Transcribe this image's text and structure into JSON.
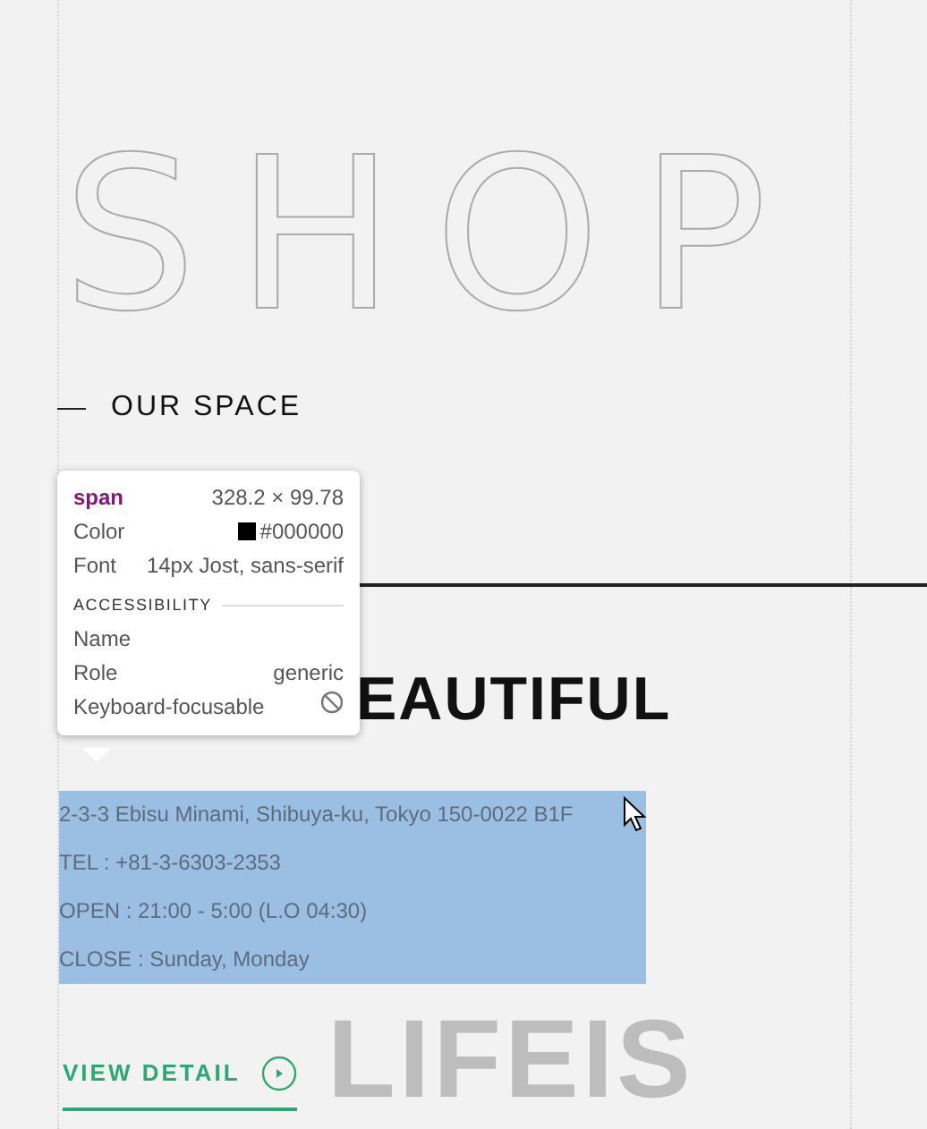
{
  "hero_title": "SHOP",
  "section_label": "OUR SPACE",
  "heading": "EAUTIFUL",
  "address_lines": [
    "2-3-3 Ebisu Minami, Shibuya-ku, Tokyo 150-0022 B1F",
    "TEL : +81-3-6303-2353",
    "OPEN : 21:00 - 5:00 (L.O 04:30)",
    "CLOSE : Sunday, Monday"
  ],
  "address_selected": true,
  "background_word": "LIFEIS",
  "link": {
    "label": "VIEW DETAIL"
  },
  "inspector_tooltip": {
    "tag": "span",
    "size": "328.2 × 99.78",
    "rows": [
      {
        "label": "Color",
        "value": "#000000",
        "kind": "color"
      },
      {
        "label": "Font",
        "value": "14px Jost, sans-serif"
      }
    ],
    "section": "ACCESSIBILITY",
    "accessibility": [
      {
        "label": "Name",
        "kind": "text"
      },
      {
        "label": "Role",
        "value": "generic",
        "kind": "text"
      },
      {
        "label": "Keyboard-focusable",
        "kind": "no"
      }
    ]
  }
}
